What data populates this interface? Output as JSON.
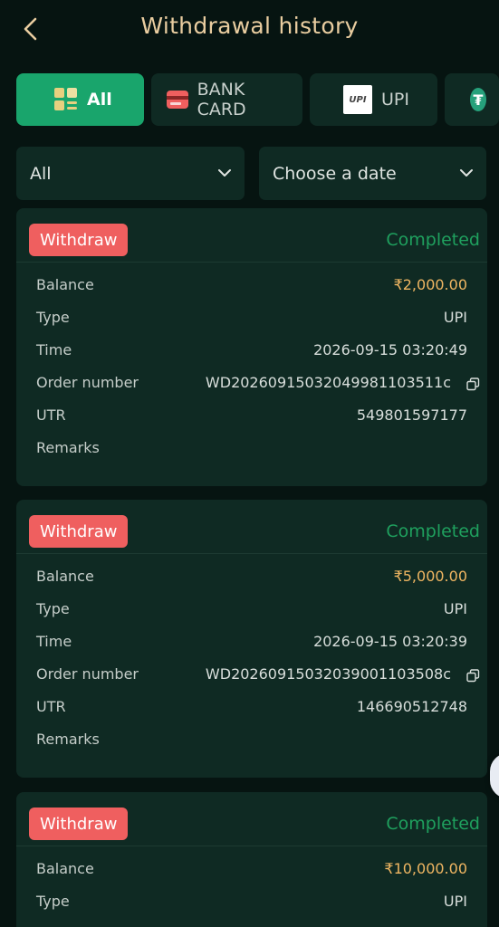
{
  "header": {
    "title": "Withdrawal history"
  },
  "tabs": [
    {
      "label": "All",
      "icon": "grid-icon",
      "active": true
    },
    {
      "label": "BANK CARD",
      "icon": "bank-card-icon",
      "active": false
    },
    {
      "label": "UPI",
      "icon": "upi-icon",
      "active": false
    },
    {
      "label": "",
      "icon": "usdt-icon",
      "active": false
    }
  ],
  "upi_logo_text": "UPI",
  "usdt_logo_text": "₮",
  "filters": {
    "type_value": "All",
    "date_placeholder": "Choose a date"
  },
  "labels": {
    "balance": "Balance",
    "type": "Type",
    "time": "Time",
    "order": "Order number",
    "utr": "UTR",
    "remarks": "Remarks"
  },
  "records": [
    {
      "badge": "Withdraw",
      "status": "Completed",
      "balance": "₹2,000.00",
      "type": "UPI",
      "time": "2026-09-15 03:20:49",
      "order": "WD20260915032049981103511c",
      "utr": "549801597177",
      "remarks": ""
    },
    {
      "badge": "Withdraw",
      "status": "Completed",
      "balance": "₹5,000.00",
      "type": "UPI",
      "time": "2026-09-15 03:20:39",
      "order": "WD20260915032039001103508c",
      "utr": "146690512748",
      "remarks": ""
    },
    {
      "badge": "Withdraw",
      "status": "Completed",
      "balance": "₹10,000.00",
      "type": "UPI"
    }
  ],
  "colors": {
    "background": "#061411",
    "card": "#0f2a23",
    "accent": "#19a56c",
    "title": "#e9cda0",
    "badge": "#ef5f5f",
    "status": "#1fa05e",
    "amount": "#f0b662"
  }
}
